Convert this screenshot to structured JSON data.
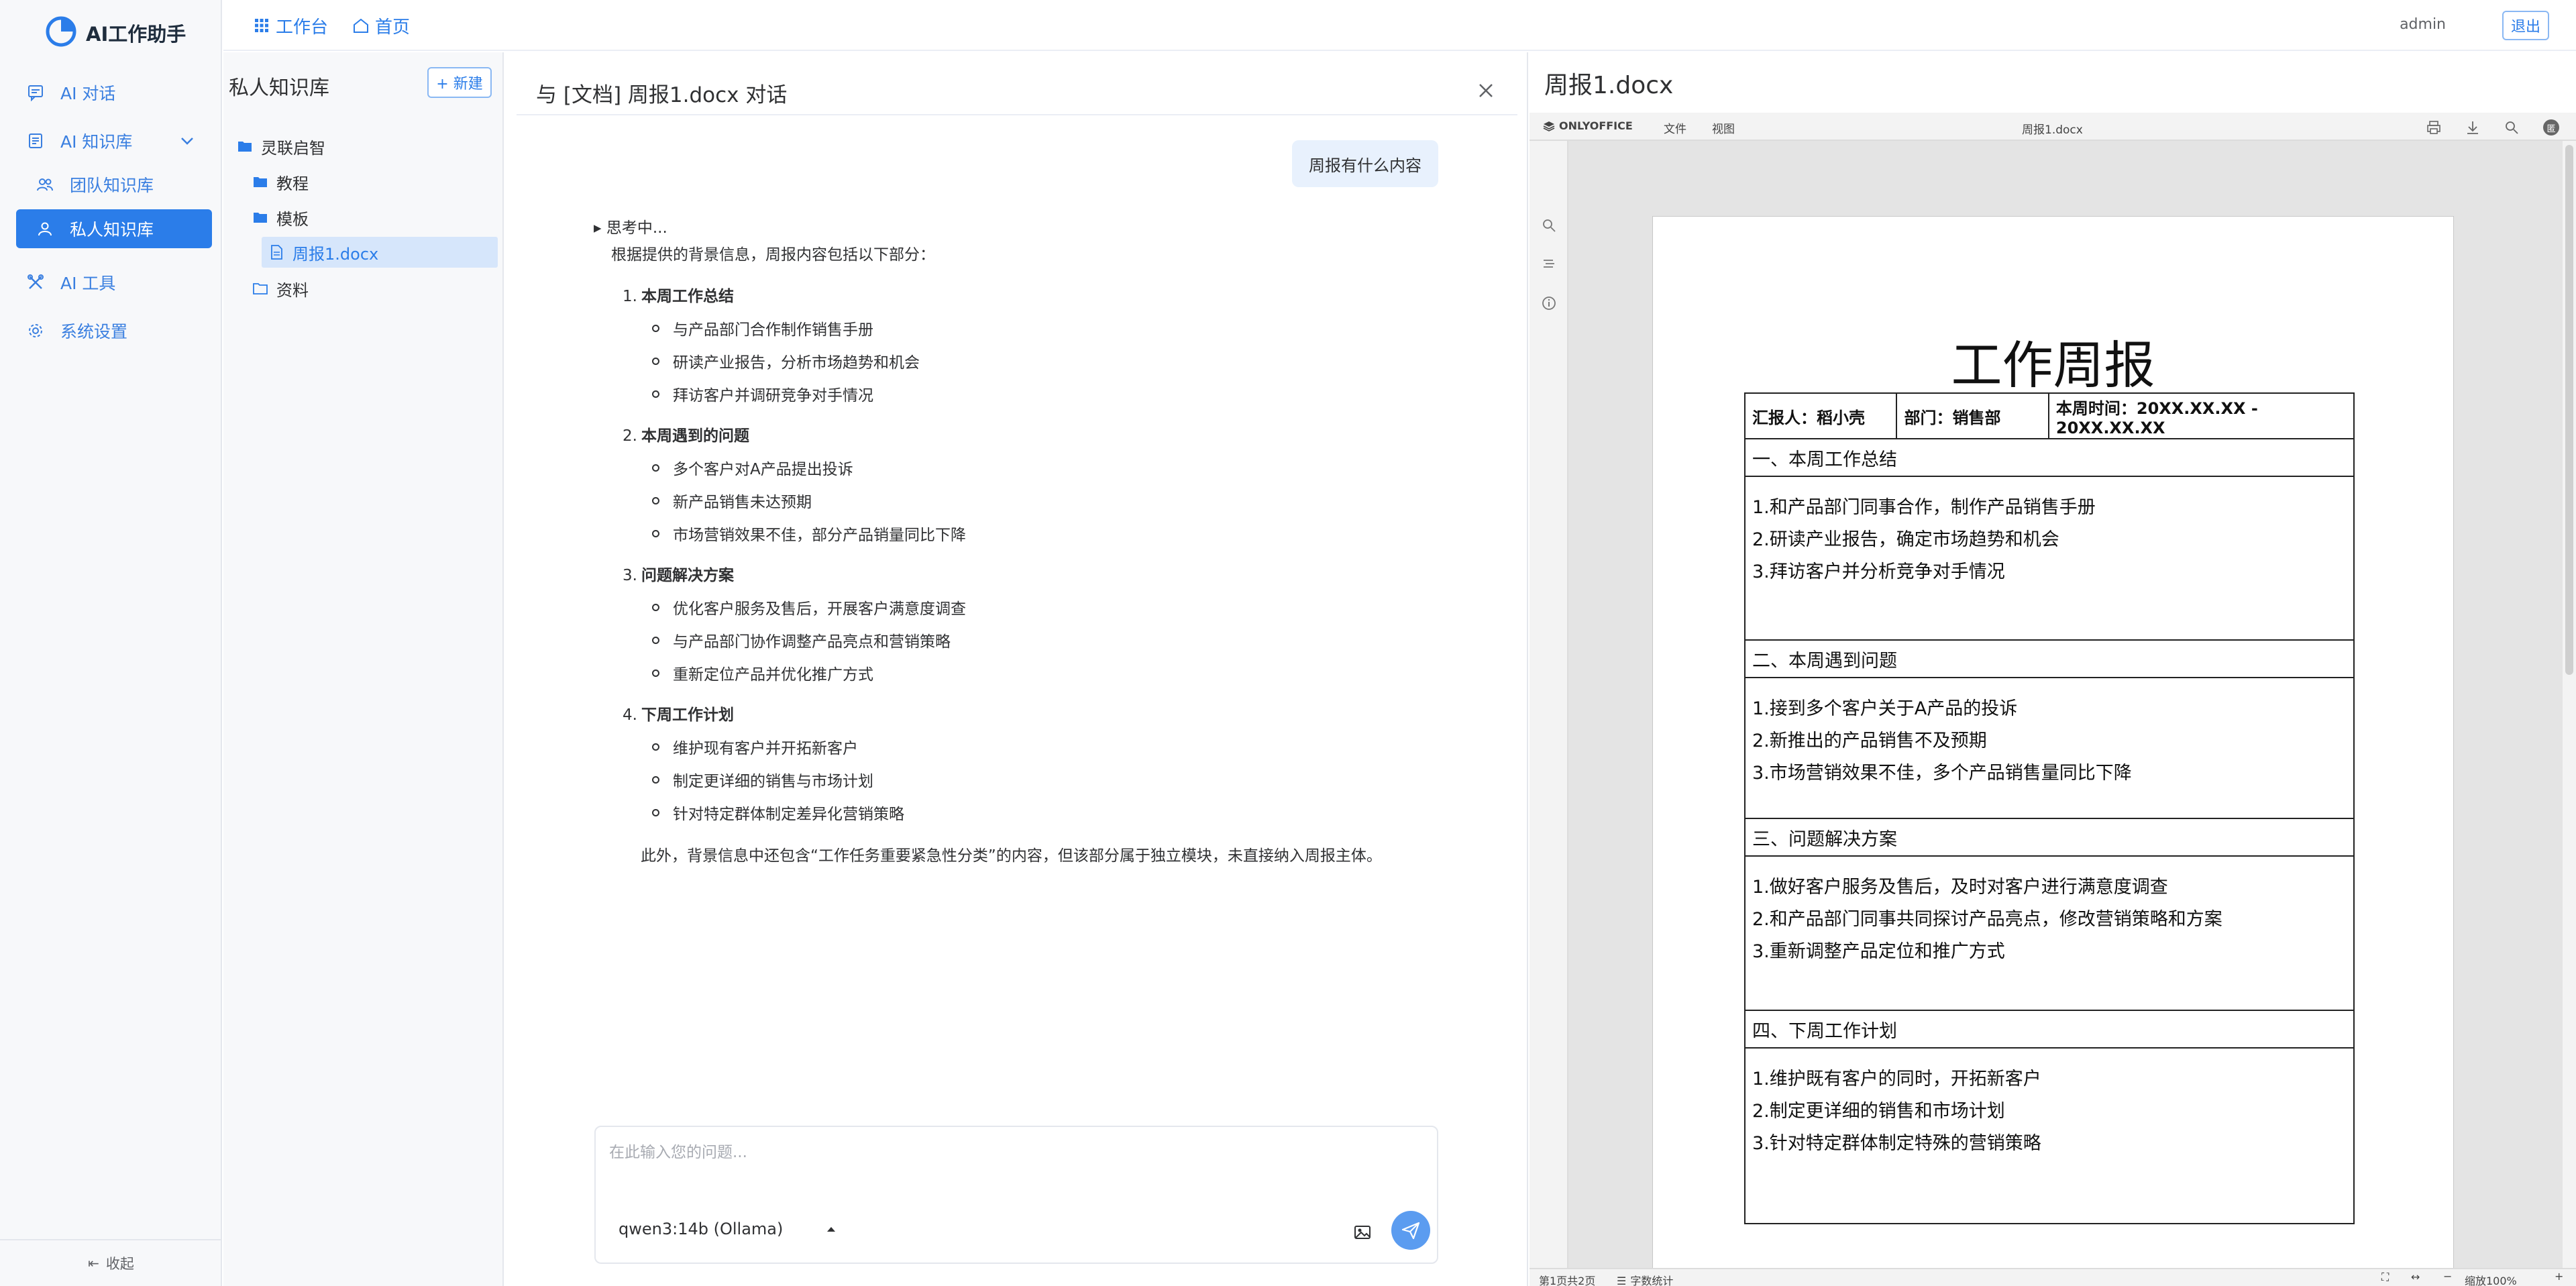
{
  "app": {
    "title": "AI工作助手"
  },
  "sidebar": {
    "items": [
      {
        "label": "AI 对话",
        "icon": "chat-icon"
      },
      {
        "label": "AI 知识库",
        "icon": "book-icon"
      },
      {
        "label": "团队知识库",
        "icon": "team-icon"
      },
      {
        "label": "私人知识库",
        "icon": "user-icon"
      },
      {
        "label": "AI 工具",
        "icon": "tools-icon"
      },
      {
        "label": "系统设置",
        "icon": "gear-icon"
      }
    ],
    "collapse_label": "收起"
  },
  "topbar": {
    "workbench_label": "工作台",
    "home_label": "首页",
    "user": "admin",
    "logout_label": "退出"
  },
  "kb": {
    "title": "私人知识库",
    "new_label": "+ 新建",
    "tree": [
      {
        "label": "灵联启智",
        "type": "folder"
      },
      {
        "label": "教程",
        "type": "folder"
      },
      {
        "label": "模板",
        "type": "folder"
      },
      {
        "label": "周报1.docx",
        "type": "file",
        "selected": true
      },
      {
        "label": "资料",
        "type": "folder-outline"
      }
    ]
  },
  "chat": {
    "title": "与 [文档] 周报1.docx 对话",
    "user_message": "周报有什么内容",
    "thinking": "▸ 思考中...",
    "intro": "根据提供的背景信息，周报内容包括以下部分：",
    "sections": [
      {
        "num": "1.",
        "title": "本周工作总结",
        "items": [
          "与产品部门合作制作销售手册",
          "研读产业报告，分析市场趋势和机会",
          "拜访客户并调研竞争对手情况"
        ]
      },
      {
        "num": "2.",
        "title": "本周遇到的问题",
        "items": [
          "多个客户对A产品提出投诉",
          "新产品销售未达预期",
          "市场营销效果不佳，部分产品销量同比下降"
        ]
      },
      {
        "num": "3.",
        "title": "问题解决方案",
        "items": [
          "优化客户服务及售后，开展客户满意度调查",
          "与产品部门协作调整产品亮点和营销策略",
          "重新定位产品并优化推广方式"
        ]
      },
      {
        "num": "4.",
        "title": "下周工作计划",
        "items": [
          "维护现有客户并开拓新客户",
          "制定更详细的销售与市场计划",
          "针对特定群体制定差异化营销策略"
        ]
      }
    ],
    "footnote": "此外，背景信息中还包含“工作任务重要紧急性分类”的内容，但该部分属于独立模块，未直接纳入周报主体。",
    "input_placeholder": "在此输入您的问题...",
    "model": "qwen3:14b (Ollama)"
  },
  "doc": {
    "title": "周报1.docx",
    "editor": {
      "brand": "ONLYOFFICE",
      "menu": [
        "文件",
        "视图"
      ],
      "filename": "周报1.docx",
      "status_page": "第1页共2页",
      "status_words": "字数统计",
      "zoom": "缩放100%",
      "avatar_letter": "匿"
    },
    "content": {
      "heading": "工作周报",
      "reporter": "汇报人：稻小壳",
      "department": "部门：销售部",
      "period": "本周时间：20XX.XX.XX - 20XX.XX.XX",
      "sections": [
        {
          "title": "一、本周工作总结",
          "lines": [
            "1.和产品部门同事合作，制作产品销售手册",
            "2.研读产业报告，确定市场趋势和机会",
            "3.拜访客户并分析竞争对手情况"
          ]
        },
        {
          "title": "二、本周遇到问题",
          "lines": [
            "1.接到多个客户关于A产品的投诉",
            "2.新推出的产品销售不及预期",
            "3.市场营销效果不佳，多个产品销售量同比下降"
          ]
        },
        {
          "title": "三、问题解决方案",
          "lines": [
            "1.做好客户服务及售后，及时对客户进行满意度调查",
            "2.和产品部门同事共同探讨产品亮点，修改营销策略和方案",
            "3.重新调整产品定位和推广方式"
          ]
        },
        {
          "title": "四、下周工作计划",
          "lines": [
            "1.维护既有客户的同时，开拓新客户",
            "2.制定更详细的销售和市场计划",
            "3.针对特定群体制定特殊的营销策略"
          ]
        }
      ]
    }
  },
  "colors": {
    "accent": "#2b7de9",
    "active_bg": "#2b7de9",
    "bubble_bg": "#e8f1fd",
    "send_bg": "#5b9cf0"
  }
}
